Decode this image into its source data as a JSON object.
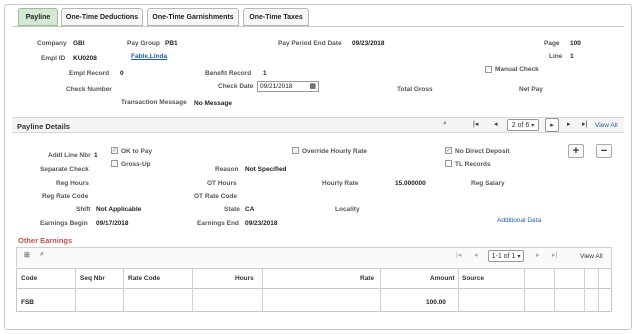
{
  "tabs": [
    {
      "label": "Payline"
    },
    {
      "label": "One-Time Deductions"
    },
    {
      "label": "One-Time Garnishments"
    },
    {
      "label": "One-Time Taxes"
    }
  ],
  "header": {
    "company_label": "Company",
    "company_value": "GBI",
    "paygroup_label": "Pay Group",
    "paygroup_value": "PB1",
    "ppe_label": "Pay Period End Date",
    "ppe_value": "09/23/2018",
    "page_label": "Page",
    "page_value": "100",
    "emplid_label": "Empl ID",
    "emplid_value": "KU0208",
    "name_link": "Fable,Linda",
    "line_label": "Line",
    "line_value": "1",
    "manual_check_label": "Manual Check",
    "emplrec_label": "Empl Record",
    "emplrec_value": "0",
    "benrec_label": "Benefit Record",
    "benrec_value": "1",
    "checknum_label": "Check Number",
    "checkdate_label": "Check Date",
    "checkdate_value": "09/21/2018",
    "totalgross_label": "Total Gross",
    "netpay_label": "Net Pay",
    "txmsg_label": "Transaction Message",
    "txmsg_value": "No Message"
  },
  "payline_details": {
    "title": "Payline Details",
    "pager": "2 of 6",
    "view_all": "View All",
    "addl_line_label": "Addl Line Nbr",
    "addl_line_value": "1",
    "ok_to_pay_label": "OK to Pay",
    "override_hourly_label": "Override Hourly Rate",
    "no_direct_deposit_label": "No Direct Deposit",
    "separate_check_label": "Separate Check",
    "grossup_label": "Gross-Up",
    "reason_label": "Reason",
    "reason_value": "Not Specified",
    "tl_records_label": "TL Records",
    "reg_hours_label": "Reg Hours",
    "ot_hours_label": "OT Hours",
    "hourly_rate_label": "Hourly Rate",
    "hourly_rate_value": "15.000000",
    "reg_salary_label": "Reg Salary",
    "reg_rate_code_label": "Reg Rate Code",
    "ot_rate_code_label": "OT Rate Code",
    "shift_label": "Shift",
    "shift_value": "Not Applicable",
    "state_label": "State",
    "state_value": "CA",
    "locality_label": "Locality",
    "earnings_begin_label": "Earnings Begin",
    "earnings_begin_value": "09/17/2018",
    "earnings_end_label": "Earnings End",
    "earnings_end_value": "09/23/2018",
    "additional_data_link": "Additional Data"
  },
  "other_earnings": {
    "title": "Other Earnings",
    "pager": "1-1 of 1",
    "view_all": "View All",
    "columns": [
      "Code",
      "Seq Nbr",
      "Rate Code",
      "Hours",
      "Rate",
      "Amount",
      "Source"
    ],
    "rows": [
      {
        "code": "FSB",
        "seq": "",
        "rate_code": "",
        "hours": "",
        "rate": "",
        "amount": "100.00",
        "source": ""
      }
    ]
  },
  "colors": {
    "accent": "#d5e8d4",
    "section_title": "#c0504d",
    "link": "#1f5fa8"
  }
}
